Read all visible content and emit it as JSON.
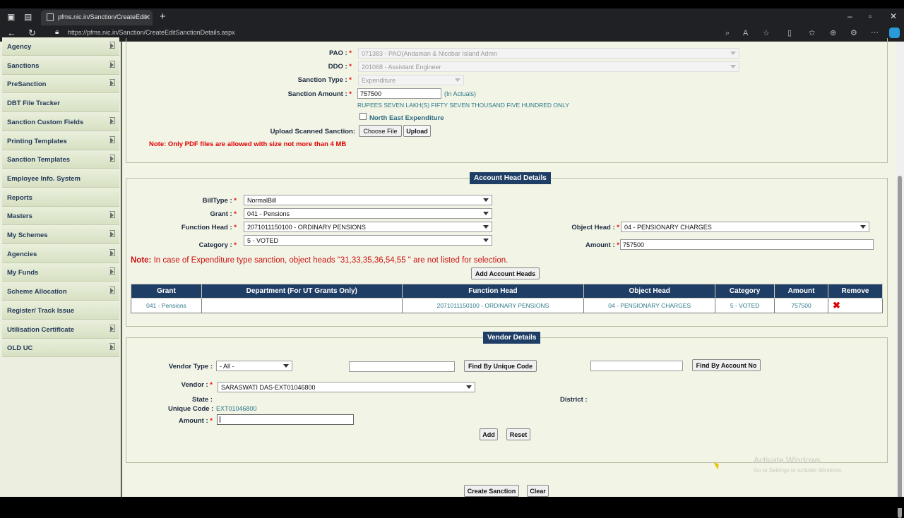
{
  "browser": {
    "tab_title": "pfms.nic.in/Sanction/CreateEdit",
    "url": "https://pfms.nic.in/Sanction/CreateEditSanctionDetails.aspx"
  },
  "sidebar": {
    "items": [
      {
        "label": "Agency",
        "arrow": true
      },
      {
        "label": "Sanctions",
        "arrow": true
      },
      {
        "label": "PreSanction",
        "arrow": true
      },
      {
        "label": "DBT File Tracker",
        "arrow": false
      },
      {
        "label": "Sanction Custom Fields",
        "arrow": true
      },
      {
        "label": "Printing Templates",
        "arrow": true
      },
      {
        "label": "Sanction Templates",
        "arrow": true
      },
      {
        "label": "Employee Info. System",
        "arrow": false
      },
      {
        "label": "Reports",
        "arrow": false
      },
      {
        "label": "Masters",
        "arrow": true
      },
      {
        "label": "My Schemes",
        "arrow": true
      },
      {
        "label": "Agencies",
        "arrow": true
      },
      {
        "label": "My Funds",
        "arrow": true
      },
      {
        "label": "Scheme Allocation",
        "arrow": true
      },
      {
        "label": "Register/ Track Issue",
        "arrow": false
      },
      {
        "label": "Utilisation Certificate",
        "arrow": true
      },
      {
        "label": "OLD UC",
        "arrow": true
      }
    ]
  },
  "sanction": {
    "pao_label": "PAO :",
    "pao_value": "071383 - PAO(Andaman & Nicobar Island Admn",
    "ddo_label": "DDO :",
    "ddo_value": "201068 - Assistant Engineer",
    "type_label": "Sanction Type :",
    "type_value": "Expenditure",
    "amount_label": "Sanction Amount :",
    "amount_value": "757500",
    "amount_unit": "(In Actuals)",
    "amount_words": "RUPEES SEVEN LAKH(S) FIFTY SEVEN THOUSAND FIVE HUNDRED ONLY",
    "ne_label": "North East Expenditure",
    "upload_label": "Upload Scanned Sanction:",
    "choose_file": "Choose File",
    "upload_btn": "Upload",
    "pdf_note": "Note: Only PDF files are allowed with size not more than 4 MB",
    "required_mark": "*"
  },
  "account_head": {
    "title": "Account Head Details",
    "billtype_label": "BillType :",
    "billtype_value": "NormalBill",
    "grant_label": "Grant :",
    "grant_value": "041 - Pensions",
    "function_label": "Function Head :",
    "function_value": "2071011150100 - ORDINARY PENSIONS",
    "category_label": "Category :",
    "category_value": "5 - VOTED",
    "object_label": "Object Head :",
    "object_value": "04 - PENSIONARY CHARGES",
    "amount_label": "Amount :",
    "amount_value": "757500",
    "note_prefix": "Note:",
    "note_text": "In case of Expenditure type sanction, object heads \"31,33,35,36,54,55 \" are not listed for selection.",
    "add_btn": "Add Account Heads",
    "table": {
      "headers": [
        "Grant",
        "Department (For UT Grants Only)",
        "Function Head",
        "Object Head",
        "Category",
        "Amount",
        "Remove"
      ],
      "rows": [
        [
          "041 - Pensions",
          "",
          "2071011150100 - ORDINARY PENSIONS",
          "04 - PENSIONARY CHARGES",
          "5 - VOTED",
          "757500",
          "✖"
        ]
      ]
    }
  },
  "vendor": {
    "title": "Vendor Details",
    "type_label": "Vendor Type :",
    "type_value": "- All -",
    "find_unique_btn": "Find By Unique Code",
    "find_account_btn": "Find By Account No",
    "vendor_label": "Vendor :",
    "vendor_value": "SARASWATI DAS-EXT01046800",
    "state_label": "State :",
    "district_label": "District :",
    "unique_label": "Unique Code :",
    "unique_value": "EXT01046800",
    "amount_label": "Amount :",
    "add_btn": "Add",
    "reset_btn": "Reset"
  },
  "footer": {
    "create_btn": "Create Sanction",
    "clear_btn": "Clear"
  },
  "watermark": {
    "line1": "Activate Windows",
    "line2": "Go to Settings to activate Windows."
  },
  "colors": {
    "header_navy": "#1f3e66",
    "panel_bg": "#f2f4e6",
    "note_red": "#e00000",
    "value_teal": "#2e7a8a"
  }
}
